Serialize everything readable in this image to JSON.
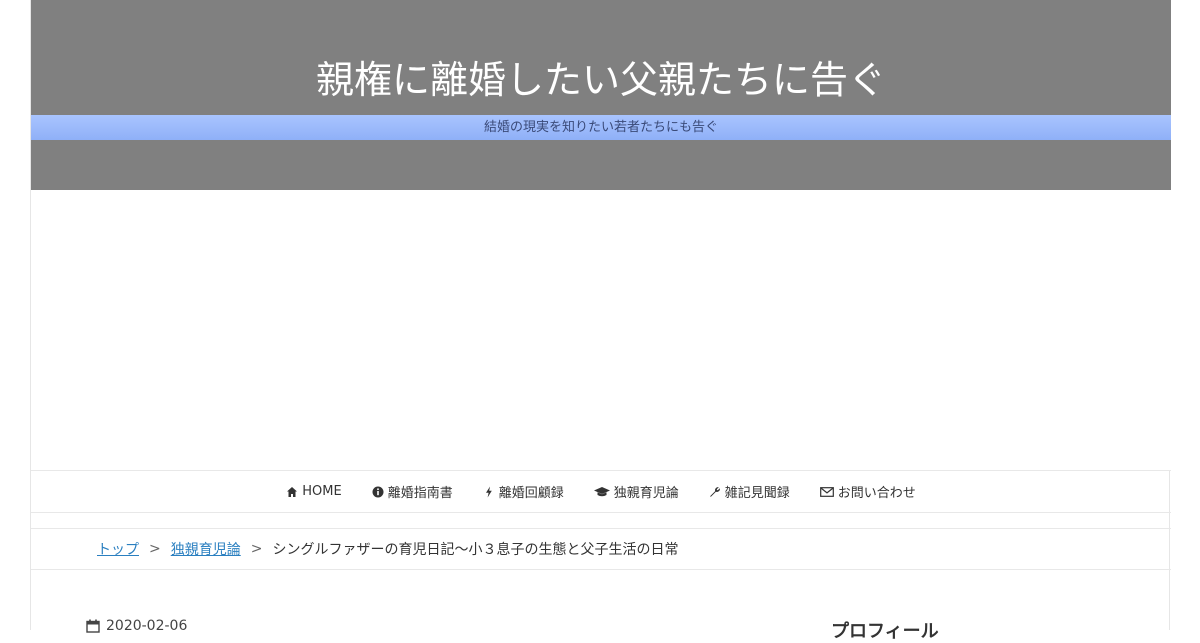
{
  "header": {
    "title": "親権に離婚したい父親たちに告ぐ",
    "tagline": "結婚の現実を知りたい若者たちにも告ぐ",
    "background_color": "#808080",
    "tagline_bar_color": "#9bb9fb"
  },
  "nav": {
    "items": [
      {
        "label": "HOME",
        "icon": "home-icon"
      },
      {
        "label": "離婚指南書",
        "icon": "info-circle-icon"
      },
      {
        "label": "離婚回顧録",
        "icon": "bolt-icon"
      },
      {
        "label": "独親育児論",
        "icon": "graduation-cap-icon"
      },
      {
        "label": "雑記見聞録",
        "icon": "wrench-icon"
      },
      {
        "label": "お問い合わせ",
        "icon": "envelope-icon"
      }
    ]
  },
  "breadcrumb": {
    "items": [
      "トップ",
      "独親育児論"
    ],
    "separator": ">",
    "current": "シングルファザーの育児日記～小３息子の生態と父子生活の日常",
    "link_color": "#2a7fc0"
  },
  "post": {
    "date": "2020-02-06",
    "date_icon": "calendar-icon"
  },
  "sidebar": {
    "heading": "プロフィール"
  }
}
